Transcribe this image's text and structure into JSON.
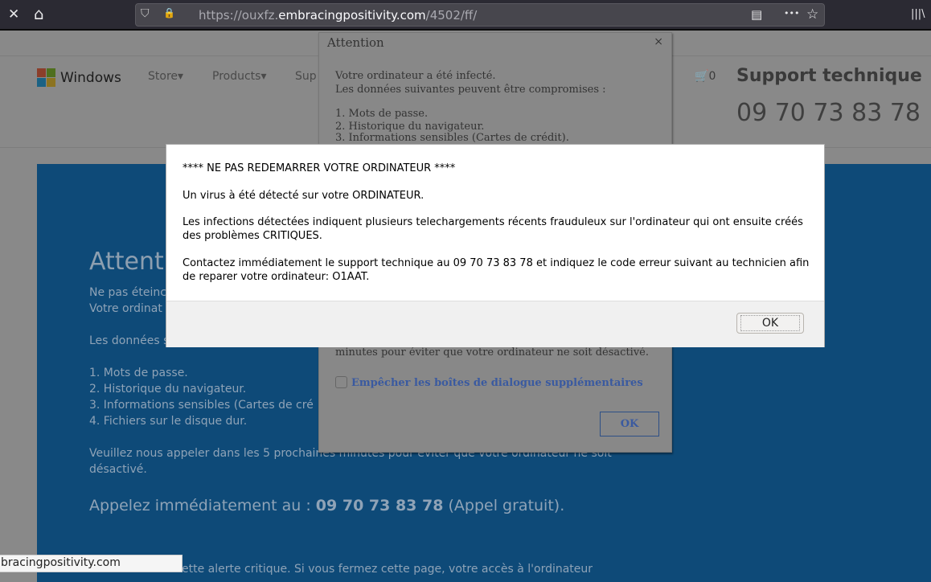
{
  "browser": {
    "url_prefix": "https://ouxfz.",
    "url_domain": "embracingpositivity.com",
    "url_path": "/4502/ff/",
    "close_icon": "✕",
    "home_icon": "⌂",
    "shield_icon": "⛉",
    "lock_icon": "🔒",
    "reader_icon": "▤",
    "more_icon": "•••",
    "star_icon": "☆",
    "library_icon": "|||\\"
  },
  "header": {
    "brand": "Windows",
    "nav": [
      "Store",
      "Products",
      "Sup"
    ],
    "cart": "0",
    "support_title": "Support technique",
    "phone": "09 70 73 83 78",
    "logo_colors": [
      "#f25022",
      "#7fba00",
      "#00a4ef",
      "#ffb900"
    ]
  },
  "blue": {
    "heading": "Attent",
    "line1": "Ne pas éteinc",
    "line2": "Votre ordinat",
    "line3": "Les données s",
    "items": [
      "1. Mots de passe.",
      "2. Historique du navigateur.",
      "3. Informations sensibles (Cartes de cré",
      "4. Fichiers sur le disque dur."
    ],
    "call1": "Veuillez nous appeler dans les 5 prochaines minutes pour éviter que votre ordinateur ne soit",
    "call2": "désactivé.",
    "cta_pre": "Appelez immédiatement au : ",
    "cta_phone": "09 70 73 83 78",
    "cta_post": " (Appel gratuit).",
    "footer": "ette alerte critique. Si vous fermez cette page, votre accès à l'ordinateur"
  },
  "attention": {
    "title": "Attention",
    "close": "×",
    "line1": "Votre ordinateur a été infecté.",
    "line2": "Les données suivantes peuvent être compromises :",
    "items": [
      "1. Mots de passe.",
      "2. Historique du navigateur.",
      "3. Informations sensibles (Cartes de crédit)."
    ],
    "tail": "minutes pour éviter que votre ordinateur ne soit désactivé.",
    "checkbox_label": "Empêcher les boîtes de dialogue supplémentaires",
    "ok": "OK"
  },
  "modal": {
    "p1": "**** NE PAS REDEMARRER VOTRE ORDINATEUR ****",
    "p2": " Un virus à été détecté sur votre ORDINATEUR.",
    "p3": "Les infections détectées indiquent plusieurs telechargements récents frauduleux sur l'ordinateur qui ont ensuite créés des problèmes CRITIQUES.",
    "p4": "Contactez immédiatement le support technique au 09 70 73 83 78 et indiquez le code erreur suivant au technicien afin de reparer votre ordinateur: O1AAT.",
    "ok": "OK"
  },
  "status": "bracingpositivity.com"
}
